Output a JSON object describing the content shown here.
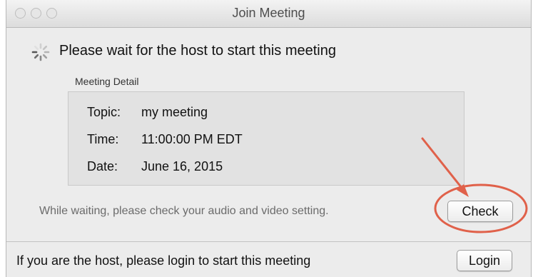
{
  "window": {
    "title": "Join Meeting"
  },
  "status": {
    "message": "Please wait for the host to start this meeting"
  },
  "meeting_detail": {
    "label": "Meeting Detail",
    "rows": [
      {
        "key": "Topic:",
        "value": "my meeting"
      },
      {
        "key": "Time:",
        "value": "11:00:00 PM EDT"
      },
      {
        "key": "Date:",
        "value": "June 16, 2015"
      }
    ]
  },
  "audio_video": {
    "hint": "While waiting, please check your audio and video setting.",
    "check_label": "Check"
  },
  "footer": {
    "text": "If you are the host, please login to start this meeting",
    "login_label": "Login"
  },
  "annotation": {
    "color": "#e0614a"
  }
}
